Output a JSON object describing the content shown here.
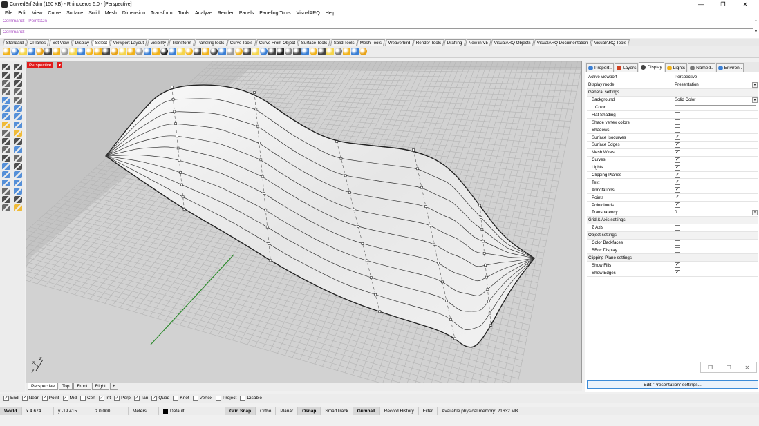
{
  "window": {
    "title": "CurvedSrf.3dm (150 KB) - Rhinoceros 5.0 - [Perspective]",
    "controls": [
      "—",
      "❐",
      "✕"
    ]
  },
  "menu": [
    "File",
    "Edit",
    "View",
    "Curve",
    "Surface",
    "Solid",
    "Mesh",
    "Dimension",
    "Transform",
    "Tools",
    "Analyze",
    "Render",
    "Panels",
    "Paneling Tools",
    "VisualARQ",
    "Help"
  ],
  "command": {
    "history": "Command: _PointsOn",
    "prompt": "Command:"
  },
  "toolbar_tabs": [
    "Standard",
    "CPlanes",
    "Set View",
    "Display",
    "Select",
    "Viewport Layout",
    "Visibility",
    "Transform",
    "PanelingTools",
    "Curve Tools",
    "Curve From Object",
    "Surface Tools",
    "Solid Tools",
    "Mesh Tools",
    "Weaverbird",
    "Render Tools",
    "Drafting",
    "New in V5",
    "VisualARQ Objects",
    "VisualARQ Documentation",
    "VisualARQ Tools"
  ],
  "toolbar_tabs_active": "Select",
  "viewport": {
    "label": "Perspective",
    "axis_z": "z",
    "axis_x": "x",
    "axis_y": "y",
    "colors": {
      "grid_bg": "#cfcfcf",
      "grid_line": "#b4b4b4",
      "x_axis": "#b42222",
      "y_axis": "#2b8a2b",
      "label_bg": "#e01b1b"
    }
  },
  "view_tabs": [
    "Perspective",
    "Top",
    "Front",
    "Right"
  ],
  "view_tabs_active": "Perspective",
  "osnap": [
    {
      "label": "End",
      "checked": true
    },
    {
      "label": "Near",
      "checked": true
    },
    {
      "label": "Point",
      "checked": true
    },
    {
      "label": "Mid",
      "checked": true
    },
    {
      "label": "Cen",
      "checked": false
    },
    {
      "label": "Int",
      "checked": true
    },
    {
      "label": "Perp",
      "checked": true
    },
    {
      "label": "Tan",
      "checked": true
    },
    {
      "label": "Quad",
      "checked": true
    },
    {
      "label": "Knot",
      "checked": false
    },
    {
      "label": "Vertex",
      "checked": false
    },
    {
      "label": "Project",
      "checked": false
    },
    {
      "label": "Disable",
      "checked": false
    }
  ],
  "status": {
    "cplane": "World",
    "x": "x 4.674",
    "y": "y -19.415",
    "z": "z 0.000",
    "units": "Meters",
    "layer": "Default",
    "buttons": [
      {
        "label": "Grid Snap",
        "on": true
      },
      {
        "label": "Ortho",
        "on": false
      },
      {
        "label": "Planar",
        "on": false
      },
      {
        "label": "Osnap",
        "on": true
      },
      {
        "label": "SmartTrack",
        "on": false
      },
      {
        "label": "Gumball",
        "on": true
      },
      {
        "label": "Record History",
        "on": false
      },
      {
        "label": "Filter",
        "on": false
      }
    ],
    "memory": "Available physical memory: 21632 MB"
  },
  "panel": {
    "tabs": [
      "Propert..",
      "Layers",
      "Display",
      "Lights",
      "Named..",
      "Environ.."
    ],
    "active_tab": "Display",
    "rows": [
      {
        "type": "field",
        "key": "Active viewport",
        "value": "Perspective"
      },
      {
        "type": "dropdown",
        "key": "Display mode",
        "value": "Presentation"
      },
      {
        "type": "section",
        "key": "General settings"
      },
      {
        "type": "dropdown",
        "key": "Background",
        "value": "Solid Color",
        "indent": 1
      },
      {
        "type": "color",
        "key": "Color:",
        "indent": 2
      },
      {
        "type": "check",
        "key": "Flat Shading",
        "checked": false,
        "indent": 1
      },
      {
        "type": "check",
        "key": "Shade vertex colors",
        "checked": false,
        "indent": 1
      },
      {
        "type": "check",
        "key": "Shadows",
        "checked": false,
        "indent": 1
      },
      {
        "type": "check",
        "key": "Surface Isocurves",
        "checked": true,
        "indent": 1
      },
      {
        "type": "check",
        "key": "Surface Edges",
        "checked": true,
        "indent": 1
      },
      {
        "type": "check",
        "key": "Mesh Wires",
        "checked": true,
        "indent": 1
      },
      {
        "type": "check",
        "key": "Curves",
        "checked": true,
        "indent": 1
      },
      {
        "type": "check",
        "key": "Lights",
        "checked": true,
        "indent": 1
      },
      {
        "type": "check",
        "key": "Clipping Planes",
        "checked": true,
        "indent": 1
      },
      {
        "type": "check",
        "key": "Text",
        "checked": true,
        "indent": 1
      },
      {
        "type": "check",
        "key": "Annotations",
        "checked": true,
        "indent": 1
      },
      {
        "type": "check",
        "key": "Points",
        "checked": true,
        "indent": 1
      },
      {
        "type": "check",
        "key": "Pointclouds",
        "checked": true,
        "indent": 1
      },
      {
        "type": "spinner",
        "key": "Transparency",
        "value": "0",
        "indent": 1
      },
      {
        "type": "section",
        "key": "Grid & Axis settings"
      },
      {
        "type": "check",
        "key": "Z Axis",
        "checked": false,
        "indent": 1
      },
      {
        "type": "section",
        "key": "Object settings"
      },
      {
        "type": "check",
        "key": "Color Backfaces",
        "checked": false,
        "indent": 1
      },
      {
        "type": "check",
        "key": "BBox Display",
        "checked": false,
        "indent": 1
      },
      {
        "type": "section",
        "key": "Clipping Plane settings"
      },
      {
        "type": "check",
        "key": "Show Fills",
        "checked": true,
        "indent": 1
      },
      {
        "type": "check",
        "key": "Show Edges",
        "checked": true,
        "indent": 1
      }
    ],
    "edit_button": "Edit \"Presentation\" settings..."
  }
}
